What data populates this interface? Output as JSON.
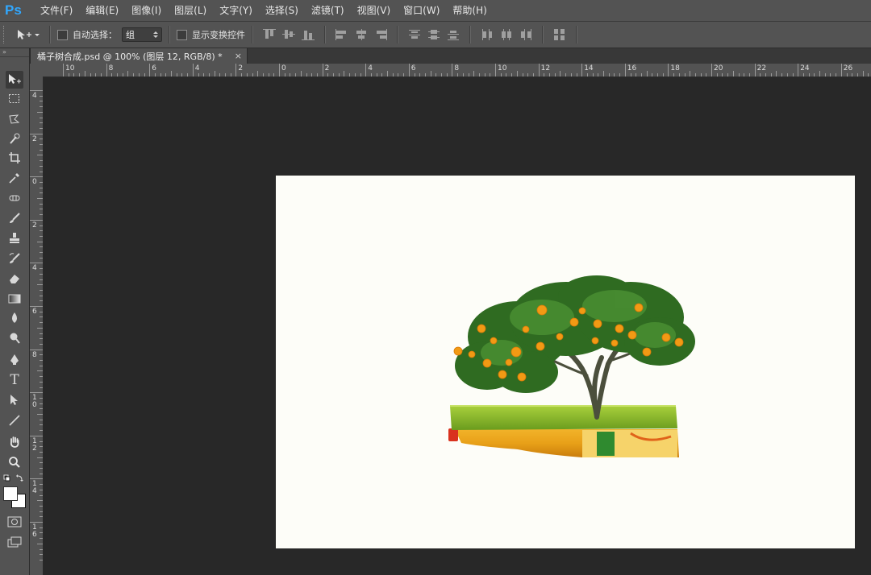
{
  "app": {
    "logo": "Ps",
    "menu": [
      "文件(F)",
      "编辑(E)",
      "图像(I)",
      "图层(L)",
      "文字(Y)",
      "选择(S)",
      "滤镜(T)",
      "视图(V)",
      "窗口(W)",
      "帮助(H)"
    ]
  },
  "options": {
    "auto_select_label": "自动选择：",
    "auto_select_checked": false,
    "auto_select_mode": "组",
    "show_transform_label": "显示变换控件",
    "show_transform_checked": false
  },
  "document": {
    "tab_title": "橘子树合成.psd @ 100% (图层 12, RGB/8) *",
    "close": "×",
    "canvas_color": "#fdfdf8"
  },
  "rulers": {
    "horizontal": [
      "10",
      "8",
      "6",
      "4",
      "2",
      "0",
      "2",
      "4",
      "6",
      "8",
      "10",
      "12",
      "14",
      "16",
      "18",
      "20",
      "22",
      "24",
      "26"
    ],
    "vertical": [
      "4",
      "2",
      "0",
      "2",
      "4",
      "6",
      "8",
      "1\n0",
      "1\n2",
      "1\n4",
      "1\n6"
    ]
  },
  "toolbox": {
    "tools": [
      "move-tool-icon",
      "marquee-tool-icon",
      "lasso-tool-icon",
      "quick-select-tool-icon",
      "crop-tool-icon",
      "eyedropper-tool-icon",
      "healing-brush-icon",
      "brush-tool-icon",
      "clone-stamp-icon",
      "history-brush-icon",
      "eraser-tool-icon",
      "gradient-tool-icon",
      "blur-tool-icon",
      "dodge-tool-icon",
      "pen-tool-icon",
      "type-tool-icon",
      "path-select-icon",
      "line-tool-icon",
      "hand-tool-icon",
      "zoom-tool-icon"
    ],
    "type_glyph": "T",
    "foreground_color": "#ffffff",
    "background_color": "#ffffff"
  }
}
